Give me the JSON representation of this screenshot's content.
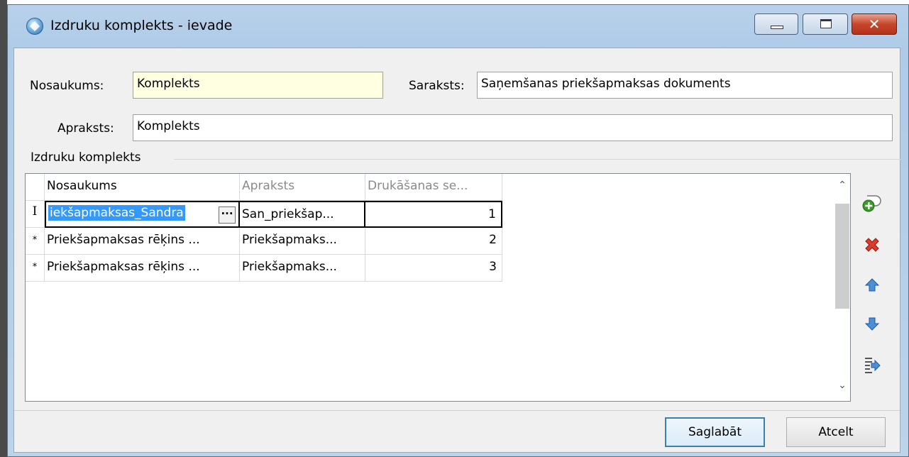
{
  "window": {
    "title": "Izdruku komplekts - ievade",
    "minimize_label": "",
    "maximize_label": "",
    "close_label": "✕"
  },
  "form": {
    "name_label": "Nosaukums:",
    "name_value": "Komplekts",
    "list_label": "Saraksts:",
    "list_value": "Saņemšanas priekšapmaksas dokuments",
    "description_label": "Apraksts:",
    "description_value": "Komplekts"
  },
  "group": {
    "title": "Izdruku komplekts"
  },
  "grid": {
    "columns": [
      "Nosaukums",
      "Apraksts",
      "Drukāšanas se..."
    ],
    "rows": [
      {
        "indicator": "I",
        "name": "iekšapmaksas_Sandra",
        "description": "San_priekšap...",
        "order": "1"
      },
      {
        "indicator": "*",
        "name": "Priekšapmaksas rēķins ...",
        "description": "Priekšapmaks...",
        "order": "2"
      },
      {
        "indicator": "*",
        "name": "Priekšapmaksas rēķins ...",
        "description": "Priekšapmaks...",
        "order": "3"
      }
    ],
    "ellipsis_label": "···",
    "scroll_up": "⌃",
    "scroll_down": "⌄"
  },
  "side_toolbar": [
    {
      "icon": "add-icon"
    },
    {
      "icon": "delete-icon"
    },
    {
      "icon": "move-up-icon"
    },
    {
      "icon": "move-down-icon"
    },
    {
      "icon": "export-icon"
    }
  ],
  "buttons": {
    "save": "Saglabāt",
    "cancel": "Atcelt"
  },
  "colors": {
    "selection": "#3399ff",
    "required_field": "#ffffe1",
    "close_button": "#c7462b"
  }
}
